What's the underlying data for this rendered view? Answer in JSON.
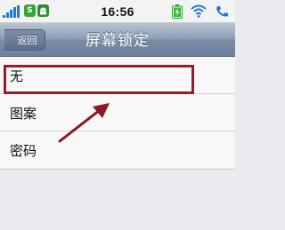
{
  "status_bar": {
    "time": "16:56",
    "icons": [
      "signal-icon",
      "s-app-icon",
      "android-app-icon",
      "battery-charging-icon",
      "wifi-icon",
      "phone-icon"
    ],
    "colors": {
      "signal": "#1e78d7",
      "app_green": "#3aa33a"
    }
  },
  "nav": {
    "back_label": "返回",
    "title": "屏幕锁定"
  },
  "options": [
    {
      "label": "无"
    },
    {
      "label": "图案"
    },
    {
      "label": "密码"
    }
  ],
  "annotation": {
    "box_color": "#9b1b2a",
    "arrow_color": "#8e1625"
  }
}
